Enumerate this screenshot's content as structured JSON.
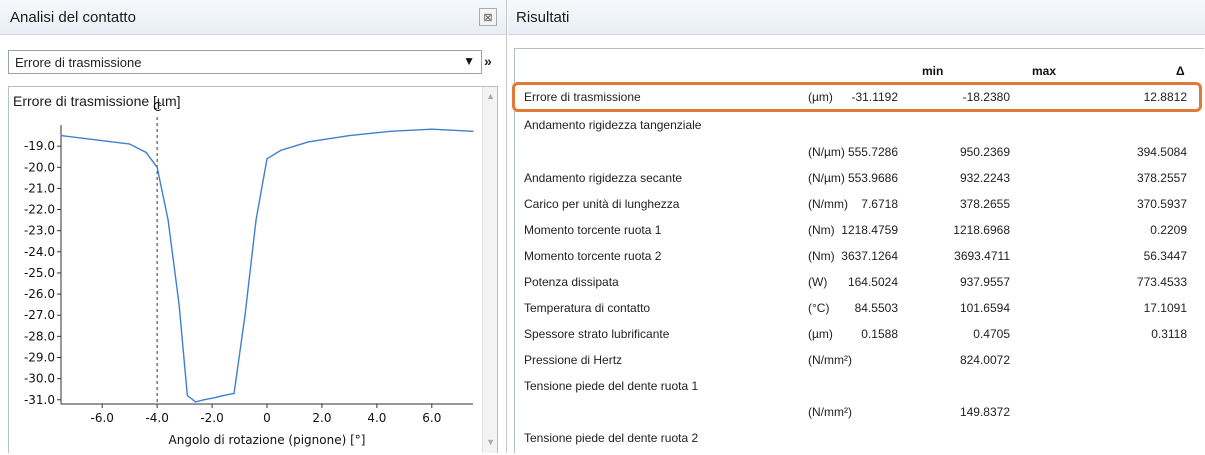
{
  "left_panel": {
    "title": "Analisi del contatto",
    "close_icon_glyph": "⊠",
    "select": {
      "value": "Errore di trasmissione"
    },
    "more_label": "»",
    "chart": {
      "title": "Errore di trasmissione [µm]",
      "xlabel": "Angolo di rotazione (pignone) [°]",
      "marker_label": "C"
    }
  },
  "right_panel": {
    "title": "Risultati",
    "columns": {
      "min": "min",
      "max": "max",
      "delta": "Δ"
    },
    "rows": [
      {
        "name": "Errore di trasmissione",
        "unit": "(µm)",
        "min": "-31.1192",
        "max": "-18.2380",
        "delta": "12.8812"
      },
      {
        "name": "Andamento rigidezza tangenziale",
        "unit": "",
        "min": "",
        "max": "",
        "delta": ""
      },
      {
        "name": "",
        "unit": "(N/µm)",
        "min": "555.7286",
        "max": "950.2369",
        "delta": "394.5084"
      },
      {
        "name": "Andamento rigidezza secante",
        "unit": "(N/µm)",
        "min": "553.9686",
        "max": "932.2243",
        "delta": "378.2557"
      },
      {
        "name": "Carico per unità di lunghezza",
        "unit": "(N/mm)",
        "min": "7.6718",
        "max": "378.2655",
        "delta": "370.5937"
      },
      {
        "name": "Momento torcente ruota 1",
        "unit": "(Nm)",
        "min": "1218.4759",
        "max": "1218.6968",
        "delta": "0.2209"
      },
      {
        "name": "Momento torcente ruota 2",
        "unit": "(Nm)",
        "min": "3637.1264",
        "max": "3693.4711",
        "delta": "56.3447"
      },
      {
        "name": "Potenza dissipata",
        "unit": "(W)",
        "min": "164.5024",
        "max": "937.9557",
        "delta": "773.4533"
      },
      {
        "name": "Temperatura di contatto",
        "unit": "(°C)",
        "min": "84.5503",
        "max": "101.6594",
        "delta": "17.1091"
      },
      {
        "name": "Spessore strato lubrificante",
        "unit": "(µm)",
        "min": "0.1588",
        "max": "0.4705",
        "delta": "0.3118"
      },
      {
        "name": "Pressione di Hertz",
        "unit": "(N/mm²)",
        "min": "",
        "max": "824.0072",
        "delta": ""
      },
      {
        "name": "Tensione piede del dente ruota 1",
        "unit": "",
        "min": "",
        "max": "",
        "delta": ""
      },
      {
        "name": "",
        "unit": "(N/mm²)",
        "min": "",
        "max": "149.8372",
        "delta": ""
      },
      {
        "name": "Tensione piede del dente ruota 2",
        "unit": "",
        "min": "",
        "max": "",
        "delta": ""
      }
    ],
    "highlight_color": "#e07a36"
  },
  "chart_data": {
    "type": "line",
    "title": "Errore di trasmissione [µm]",
    "xlabel": "Angolo di rotazione (pignone) [°]",
    "ylabel": "",
    "xlim": [
      -7.5,
      7.5
    ],
    "ylim": [
      -31.2,
      -18.0
    ],
    "x_ticks": [
      -6.0,
      -4.0,
      -2.0,
      0,
      2.0,
      4.0,
      6.0
    ],
    "x_tick_labels": [
      "-6.0",
      "-4.0",
      "-2.0",
      "0",
      "2.0",
      "4.0",
      "6.0"
    ],
    "y_ticks": [
      -19,
      -20,
      -21,
      -22,
      -23,
      -24,
      -25,
      -26,
      -27,
      -28,
      -29,
      -30,
      -31
    ],
    "y_tick_labels": [
      "-19.0",
      "-20.0",
      "-21.0",
      "-22.0",
      "-23.0",
      "-24.0",
      "-25.0",
      "-26.0",
      "-27.0",
      "-28.0",
      "-29.0",
      "-30.0",
      "-31.0"
    ],
    "marker": {
      "x": -4.0,
      "label": "C"
    },
    "series": [
      {
        "color": "#3f7fd0",
        "x": [
          -7.5,
          -5.0,
          -4.4,
          -4.0,
          -3.6,
          -3.2,
          -2.9,
          -2.6,
          -2.3,
          -1.9,
          -1.6,
          -1.2,
          -0.8,
          -0.4,
          0.0,
          0.5,
          1.5,
          3.0,
          4.5,
          6.0,
          7.5
        ],
        "y": [
          -18.5,
          -18.9,
          -19.3,
          -20.0,
          -22.5,
          -26.5,
          -30.8,
          -31.1,
          -31.0,
          -30.9,
          -30.8,
          -30.7,
          -27.0,
          -22.5,
          -19.6,
          -19.2,
          -18.8,
          -18.5,
          -18.3,
          -18.2,
          -18.3
        ]
      }
    ]
  }
}
